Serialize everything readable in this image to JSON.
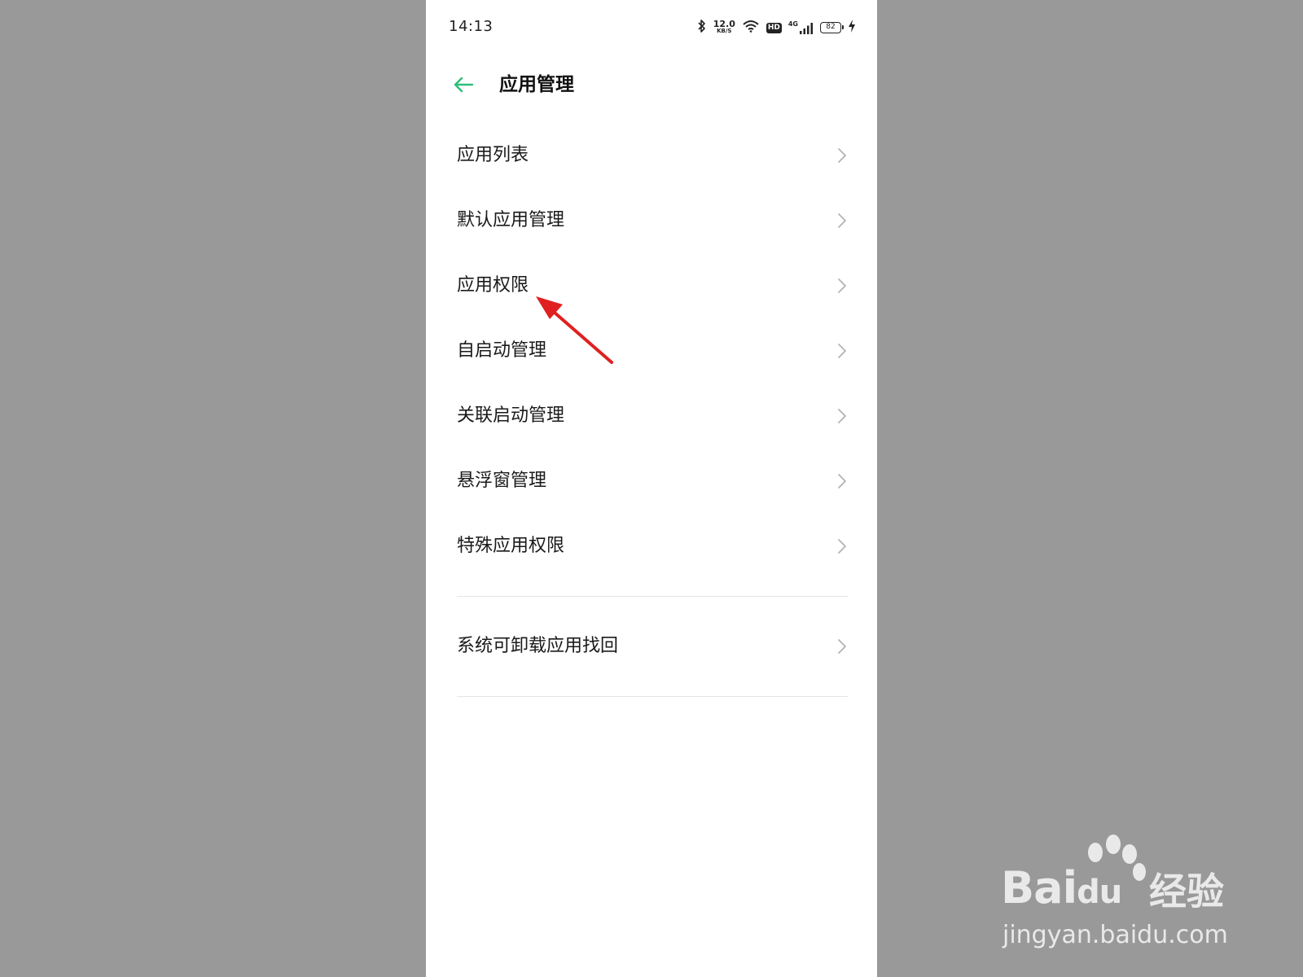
{
  "status_bar": {
    "time": "14:13",
    "net_speed_value": "12.0",
    "net_speed_unit": "KB/S",
    "network_type": "4G",
    "hd_label": "HD",
    "battery_level": "82",
    "icons": [
      "bluetooth-icon",
      "wifi-icon",
      "hd-icon",
      "signal-icon",
      "battery-icon",
      "charging-icon"
    ]
  },
  "header": {
    "title": "应用管理",
    "back_icon": "arrow-left-icon",
    "accent_color": "#2dbf7a"
  },
  "menu": {
    "group1": [
      {
        "label": "应用列表"
      },
      {
        "label": "默认应用管理"
      },
      {
        "label": "应用权限"
      },
      {
        "label": "自启动管理"
      },
      {
        "label": "关联启动管理"
      },
      {
        "label": "悬浮窗管理"
      },
      {
        "label": "特殊应用权限"
      }
    ],
    "group2": [
      {
        "label": "系统可卸载应用找回"
      }
    ],
    "chevron_icon": "chevron-right-icon"
  },
  "annotation": {
    "arrow_color": "#e02020"
  },
  "watermark": {
    "brand": "Bai",
    "brand_du": "du",
    "cn": "经验",
    "url": "jingyan.baidu.com"
  }
}
